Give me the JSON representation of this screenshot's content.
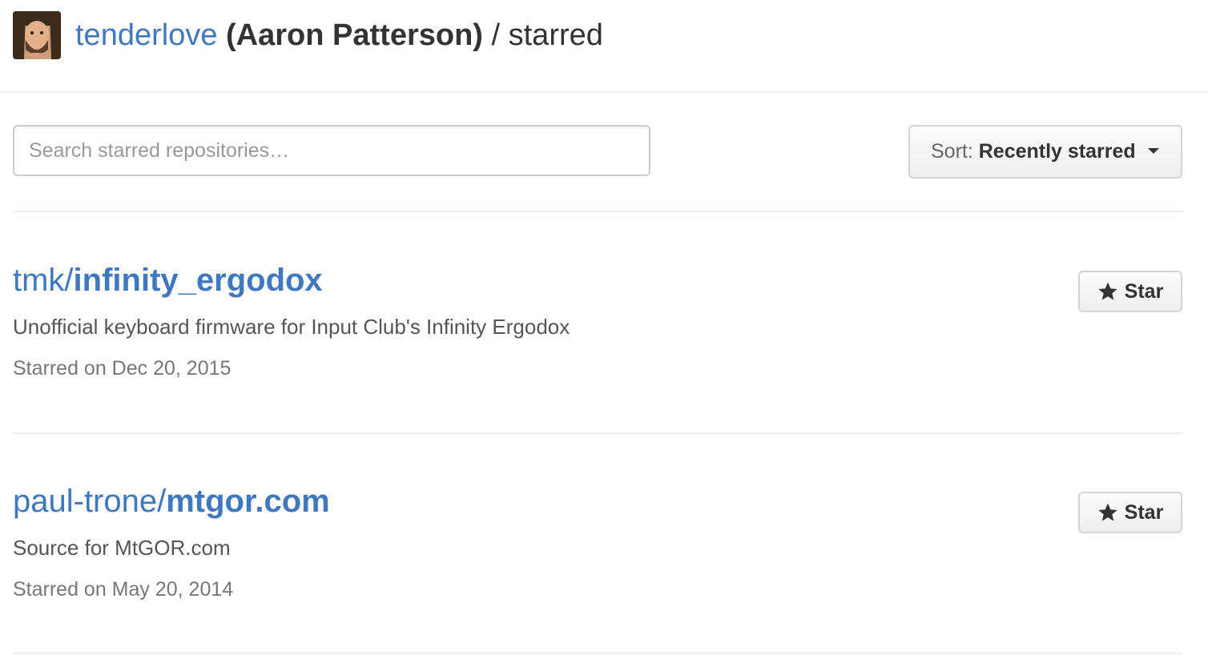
{
  "header": {
    "username": "tenderlove",
    "fullname": "(Aaron Patterson)",
    "section": " / starred"
  },
  "search": {
    "placeholder": "Search starred repositories…",
    "value": ""
  },
  "sort": {
    "prefix": "Sort:",
    "value": "Recently starred",
    "icon": "caret-down-icon"
  },
  "repos": [
    {
      "owner": "tmk/",
      "name": "infinity_ergodox",
      "description": "Unofficial keyboard firmware for Input Club's Infinity Ergodox",
      "starred": "Starred on Dec 20, 2015",
      "star_label": "Star"
    },
    {
      "owner": "paul-trone/",
      "name": "mtgor.com",
      "description": "Source for MtGOR.com",
      "starred": "Starred on May 20, 2014",
      "star_label": "Star"
    }
  ],
  "colors": {
    "link": "#4078c0",
    "text": "#333333",
    "muted": "#777777",
    "border": "#eeeeee"
  }
}
